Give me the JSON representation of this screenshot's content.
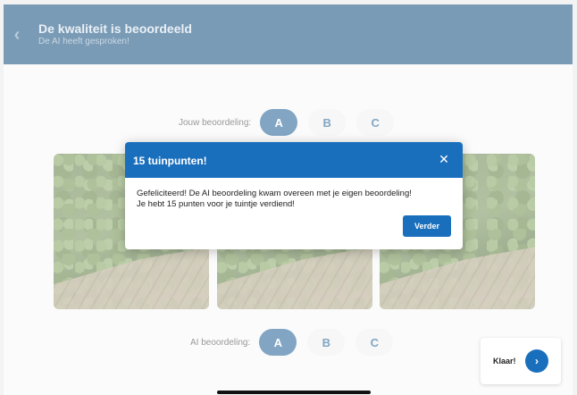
{
  "header": {
    "title": "De kwaliteit is beoordeeld",
    "subtitle": "De AI heeft gesproken!"
  },
  "user_rating": {
    "label": "Jouw beoordeling:",
    "options": [
      "A",
      "B",
      "C"
    ],
    "selected": "A"
  },
  "ai_rating": {
    "label": "AI beoordeling:",
    "options": [
      "A",
      "B",
      "C"
    ],
    "selected": "A"
  },
  "photos": [
    "garden-photo-1",
    "garden-photo-2",
    "garden-photo-3"
  ],
  "modal": {
    "title": "15 tuinpunten!",
    "close_icon": "close-icon",
    "body_line1": "Gefeliciteerd! De AI beoordeling kwam overeen met je eigen beoordeling!",
    "body_line2": "Je hebt 15 punten voor je tuintje verdiend!",
    "button_label": "Verder"
  },
  "done": {
    "label": "Klaar!",
    "icon": "chevron-right-icon"
  },
  "colors": {
    "header_bg": "#0d4a7a",
    "accent": "#1a6fbd",
    "grade_selected": "#1a5c92"
  }
}
